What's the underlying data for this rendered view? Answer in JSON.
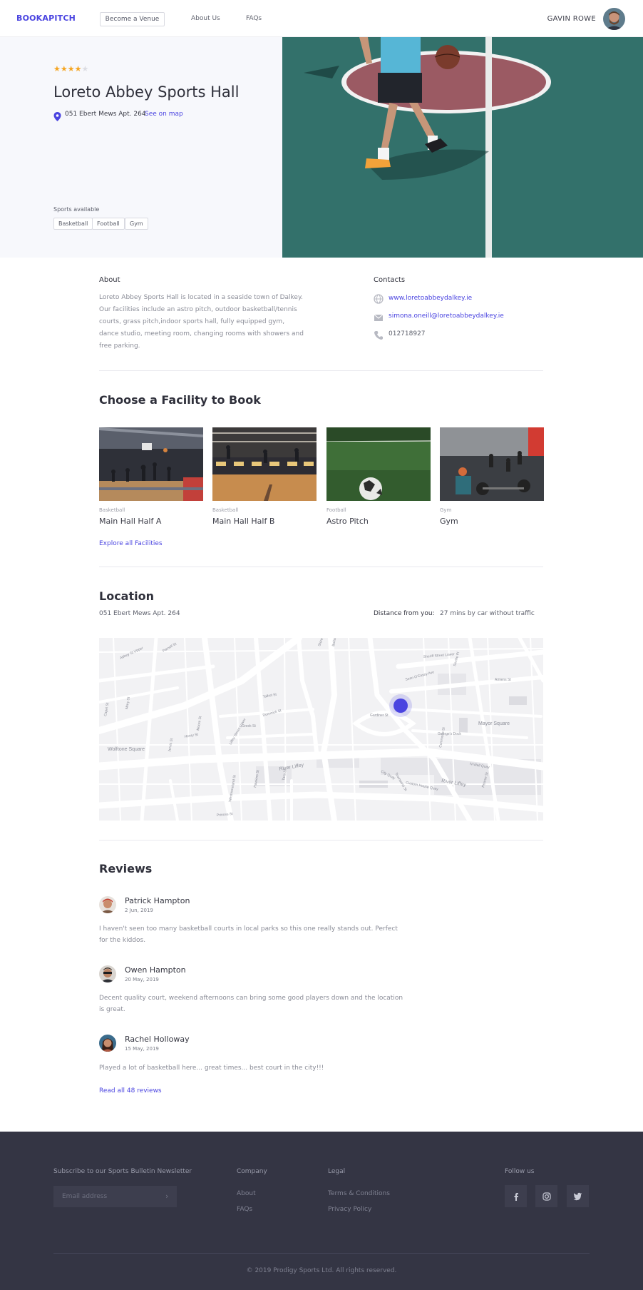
{
  "header": {
    "logo": "BOOKAPITCH",
    "become_venue": "Become a Venue",
    "nav": [
      "About Us",
      "FAQs"
    ],
    "user_name": "GAVIN ROWE"
  },
  "venue": {
    "rating": 4,
    "rating_max": 5,
    "title": "Loreto Abbey Sports Hall",
    "address": "051 Ebert Mews Apt. 264",
    "see_map": "See on map",
    "sports_label": "Sports available",
    "sports": [
      "Basketball",
      "Football",
      "Gym"
    ]
  },
  "about": {
    "label": "About",
    "text": "Loreto Abbey Sports Hall is located in a seaside town of Dalkey. Our facilities include an astro pitch, outdoor basketball/tennis courts, grass pitch,indoor sports hall, fully equipped gym, dance studio, meeting room, changing rooms with showers and free parking."
  },
  "contacts": {
    "label": "Contacts",
    "website": "www.loretoabbeydalkey.ie",
    "email": "simona.oneill@loretoabbeydalkey.ie",
    "phone": "012718927"
  },
  "facilities": {
    "title": "Choose a Facility to Book",
    "items": [
      {
        "category": "Basketball",
        "name": "Main Hall Half A"
      },
      {
        "category": "Basketball",
        "name": "Main Hall Half B"
      },
      {
        "category": "Football",
        "name": "Astro Pitch"
      },
      {
        "category": "Gym",
        "name": "Gym"
      }
    ],
    "explore": "Explore all Facilities"
  },
  "location": {
    "title": "Location",
    "address": "051 Ebert Mews Apt. 264",
    "distance_label": "Distance from you:",
    "distance_value": "27 mins by car without traffic",
    "map_labels": [
      "Wolftone Square",
      "Mayor Square",
      "River Liffey",
      "River Liffey",
      "N Wall Quay",
      "Custom House Quay",
      "Talbot St",
      "Store St",
      "Abbey St Upper",
      "Parnell St",
      "Mary St",
      "Moore St",
      "Henry St",
      "Sheriff Street Lower",
      "Seville Pl",
      "Amiens St",
      "Sean O'Casey Ave",
      "Gardiner St",
      "George's Dock",
      "Commons St",
      "City Quay",
      "Townsend St",
      "Pearse St",
      "Capel St",
      "Jervis St",
      "Liffey Street Lower",
      "Bolton St",
      "Dominick St",
      "Greek St",
      "Princes St",
      "Westmoreland St",
      "Hawkins St",
      "Tara St"
    ]
  },
  "reviews": {
    "title": "Reviews",
    "items": [
      {
        "name": "Patrick Hampton",
        "date": "2 Jun, 2019",
        "text": "I haven't seen too many basketball courts in local parks so this one really stands out. Perfect for the kiddos."
      },
      {
        "name": "Owen Hampton",
        "date": "20 May, 2019",
        "text": "Decent quality court, weekend afternoons can bring some good players down and the location is great."
      },
      {
        "name": "Rachel Holloway",
        "date": "15 May, 2019",
        "text": "Played a lot of basketball here... great times... best court in the city!!!"
      }
    ],
    "read_all": "Read all 48 reviews"
  },
  "footer": {
    "newsletter_label": "Subscribe to our Sports Bulletin Newsletter",
    "email_placeholder": "Email address",
    "company_label": "Company",
    "company_links": [
      "About",
      "FAQs"
    ],
    "legal_label": "Legal",
    "legal_links": [
      "Terms & Conditions",
      "Privacy Policy"
    ],
    "follow_label": "Follow us",
    "social": [
      "facebook-icon",
      "instagram-icon",
      "twitter-icon"
    ],
    "copyright": "© 2019 Prodigy Sports Ltd. All rights reserved."
  },
  "colors": {
    "brand": "#4a44e0",
    "star": "#f5a623",
    "footer_bg": "#343544",
    "hero_bg": "#f7f8fc"
  }
}
